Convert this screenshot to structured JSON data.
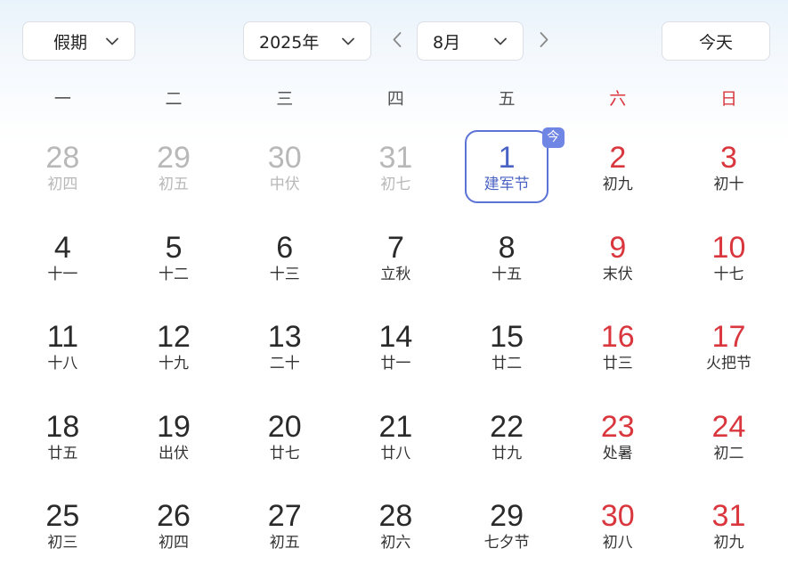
{
  "toolbar": {
    "holiday_label": "假期",
    "year_label": "2025年",
    "month_label": "8月",
    "today_label": "今天"
  },
  "weekdays": [
    "一",
    "二",
    "三",
    "四",
    "五",
    "六",
    "日"
  ],
  "today_badge": "今",
  "colors": {
    "accent": "#5b73d6",
    "weekend": "#d9363e",
    "other_month": "#b8b8b8"
  },
  "weeks": [
    [
      {
        "day": "28",
        "lunar": "初四",
        "other": true
      },
      {
        "day": "29",
        "lunar": "初五",
        "other": true
      },
      {
        "day": "30",
        "lunar": "中伏",
        "other": true
      },
      {
        "day": "31",
        "lunar": "初七",
        "other": true
      },
      {
        "day": "1",
        "lunar": "建军节",
        "today": true
      },
      {
        "day": "2",
        "lunar": "初九"
      },
      {
        "day": "3",
        "lunar": "初十"
      }
    ],
    [
      {
        "day": "4",
        "lunar": "十一"
      },
      {
        "day": "5",
        "lunar": "十二"
      },
      {
        "day": "6",
        "lunar": "十三"
      },
      {
        "day": "7",
        "lunar": "立秋"
      },
      {
        "day": "8",
        "lunar": "十五"
      },
      {
        "day": "9",
        "lunar": "末伏"
      },
      {
        "day": "10",
        "lunar": "十七"
      }
    ],
    [
      {
        "day": "11",
        "lunar": "十八"
      },
      {
        "day": "12",
        "lunar": "十九"
      },
      {
        "day": "13",
        "lunar": "二十"
      },
      {
        "day": "14",
        "lunar": "廿一"
      },
      {
        "day": "15",
        "lunar": "廿二"
      },
      {
        "day": "16",
        "lunar": "廿三"
      },
      {
        "day": "17",
        "lunar": "火把节"
      }
    ],
    [
      {
        "day": "18",
        "lunar": "廿五"
      },
      {
        "day": "19",
        "lunar": "出伏"
      },
      {
        "day": "20",
        "lunar": "廿七"
      },
      {
        "day": "21",
        "lunar": "廿八"
      },
      {
        "day": "22",
        "lunar": "廿九"
      },
      {
        "day": "23",
        "lunar": "处暑"
      },
      {
        "day": "24",
        "lunar": "初二"
      }
    ],
    [
      {
        "day": "25",
        "lunar": "初三"
      },
      {
        "day": "26",
        "lunar": "初四"
      },
      {
        "day": "27",
        "lunar": "初五"
      },
      {
        "day": "28",
        "lunar": "初六"
      },
      {
        "day": "29",
        "lunar": "七夕节"
      },
      {
        "day": "30",
        "lunar": "初八"
      },
      {
        "day": "31",
        "lunar": "初九"
      }
    ]
  ]
}
